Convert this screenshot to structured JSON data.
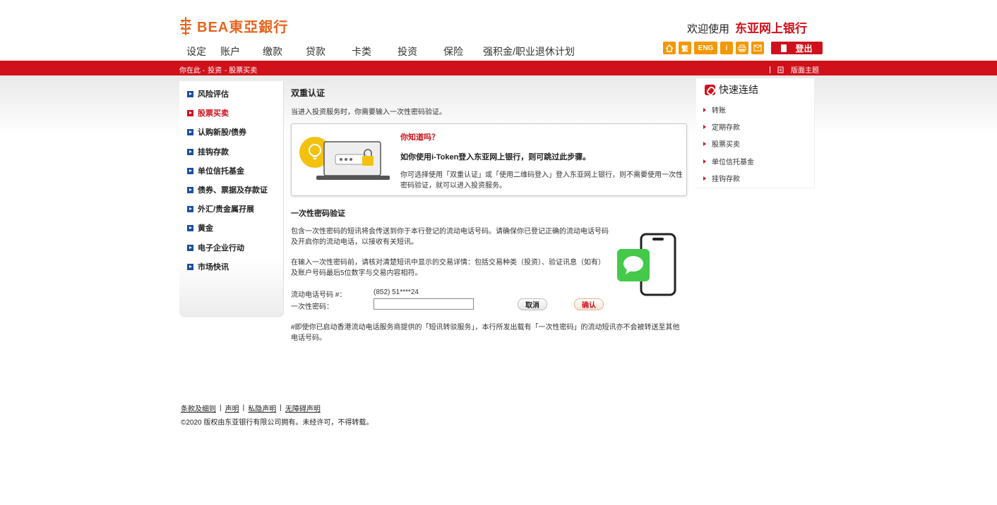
{
  "header": {
    "logo_text": "BEA東亞銀行",
    "welcome_prefix": "欢迎使用",
    "welcome_brand": "东亚网上银行",
    "nav": [
      "设定",
      "账户",
      "缴款",
      "贷款",
      "卡类",
      "投资",
      "保险",
      "强积金/职业退休计划"
    ],
    "tools": [
      "home-icon",
      "繁",
      "ENG",
      "i",
      "print-icon",
      "mail-icon"
    ],
    "logout_label": "登出"
  },
  "breadcrumb": {
    "prefix": "你在此 -",
    "items": [
      "投资",
      "- 股票买卖"
    ]
  },
  "theme_label": "版面主题",
  "sidebar": {
    "items": [
      {
        "label": "风险评估",
        "active": false
      },
      {
        "label": "股票买卖",
        "active": true
      },
      {
        "label": "认购新股/债券",
        "active": false
      },
      {
        "label": "挂钩存款",
        "active": false
      },
      {
        "label": "单位信托基金",
        "active": false
      },
      {
        "label": "债券、票据及存款证",
        "active": false
      },
      {
        "label": "外汇/贵金属孖展",
        "active": false
      },
      {
        "label": "黄金",
        "active": false
      },
      {
        "label": "电子企业行动",
        "active": false
      },
      {
        "label": "市场快讯",
        "active": false
      }
    ]
  },
  "main": {
    "title": "双重认证",
    "intro": "当进入投资服务时，你需要输入一次性密码验证。",
    "tip": {
      "title": "你知道吗？",
      "bold": "如你使用i-Token登入东亚网上银行，则可跳过此步骤。",
      "body": "你可选择使用「双重认证」或「使用二维码登入」登入东亚网上银行，则不需要使用一次性密码验证，就可以进入投资服务。"
    },
    "otp_title": "一次性密码验证",
    "otp_p1": "包含一次性密码的短讯将会传送到你于本行登记的流动电话号码。请确保你已登记正确的流动电话号码及开启你的流动电话，以接收有关短讯。",
    "otp_p2": "在输入一次性密码前，请核对清楚短讯中显示的交易详情：包括交易种类（投资）、验证讯息（如有）及账户号码最后5位数字与交易内容相符。",
    "phone_label": "流动电话号码 #：",
    "phone_value": "(852) 51****24",
    "otp_label": "一次性密码：",
    "otp_value": "",
    "cancel_label": "取消",
    "confirm_label": "确认",
    "note": "#即使你已启动香港流动电话服务商提供的「短讯转驳服务」，本行所发出载有「一次性密码」的流动短讯亦不会被转送至其他电话号码。"
  },
  "quick_links": {
    "title": "快速连结",
    "items": [
      "转账",
      "定期存款",
      "股票买卖",
      "单位信托基金",
      "挂钩存款"
    ]
  },
  "footer": {
    "links": [
      "条款及细则",
      "声明",
      "私隐声明",
      "无障碍声明"
    ],
    "copyright": "©2020 版权由东亚银行有限公司拥有。未经许可，不得转载。"
  },
  "colors": {
    "brand_red": "#d0111b",
    "logo_orange": "#e8641c",
    "tool_orange": "#f39800",
    "sidebar_bullet_blue": "#1d4f9c"
  }
}
